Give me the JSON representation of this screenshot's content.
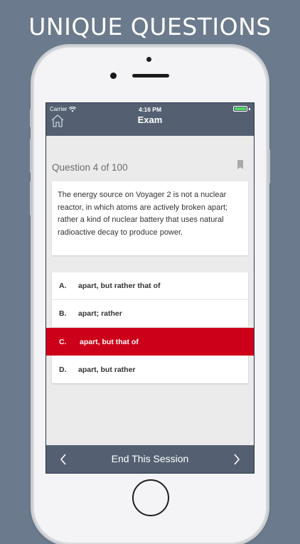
{
  "promo": {
    "title": "UNIQUE QUESTIONS"
  },
  "status_bar": {
    "carrier": "Carrier",
    "time": "4:16 PM",
    "battery_color": "#4cd964"
  },
  "nav": {
    "title": "Exam",
    "home_icon": "home-icon"
  },
  "question": {
    "counter": "Question 4 of 100",
    "bookmark_icon": "bookmark-icon",
    "text": "The energy source on Voyager 2 is not a nuclear reactor, in which atoms are actively broken apart; rather a kind of nuclear battery that uses natural radioactive decay to produce power."
  },
  "answers": [
    {
      "letter": "A.",
      "text": "apart, but rather that of",
      "selected": false
    },
    {
      "letter": "B.",
      "text": "apart; rather",
      "selected": false
    },
    {
      "letter": "C.",
      "text": "apart, but that of",
      "selected": true
    },
    {
      "letter": "D.",
      "text": "apart, but rather",
      "selected": false
    }
  ],
  "bottom_bar": {
    "label": "End This Session",
    "prev_icon": "chevron-left-icon",
    "next_icon": "chevron-right-icon"
  },
  "colors": {
    "background": "#6b7a8c",
    "navbar": "#546072",
    "selected_answer": "#cc0018"
  }
}
